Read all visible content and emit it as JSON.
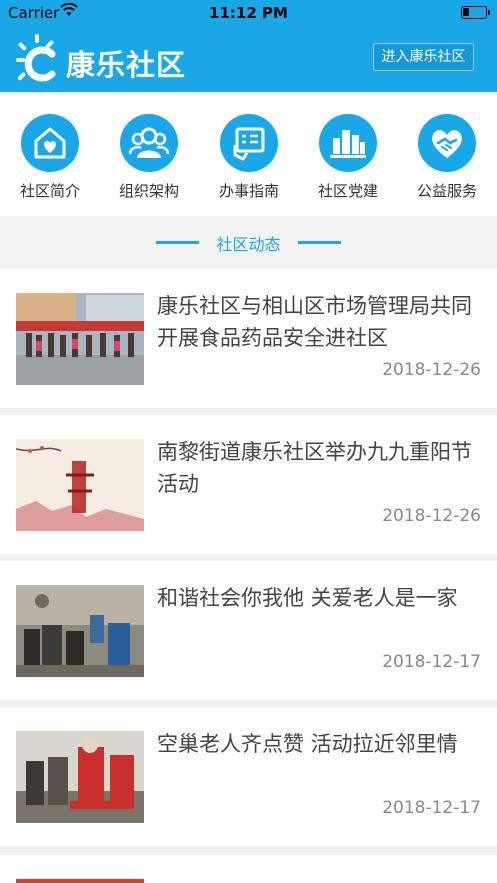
{
  "status": {
    "carrier": "Carrier",
    "time": "11:12 PM"
  },
  "header": {
    "brand": "康乐社区",
    "enter_button": "进入康乐社区"
  },
  "nav": [
    {
      "label": "社区简介",
      "icon": "community-home-icon"
    },
    {
      "label": "组织架构",
      "icon": "organization-icon"
    },
    {
      "label": "办事指南",
      "icon": "guide-tablet-icon"
    },
    {
      "label": "社区党建",
      "icon": "party-building-icon"
    },
    {
      "label": "公益服务",
      "icon": "handshake-icon"
    }
  ],
  "section": {
    "title": "社区动态"
  },
  "news": [
    {
      "title": "康乐社区与相山区市场管理局共同开展食品药品安全进社区",
      "date": "2018-12-26"
    },
    {
      "title": "南黎街道康乐社区举办九九重阳节活动",
      "date": "2018-12-26"
    },
    {
      "title": "和谐社会你我他 关爱老人是一家",
      "date": "2018-12-17"
    },
    {
      "title": "空巢老人齐点赞 活动拉近邻里情",
      "date": "2018-12-17"
    }
  ],
  "colors": {
    "accent": "#1aa7e8"
  }
}
